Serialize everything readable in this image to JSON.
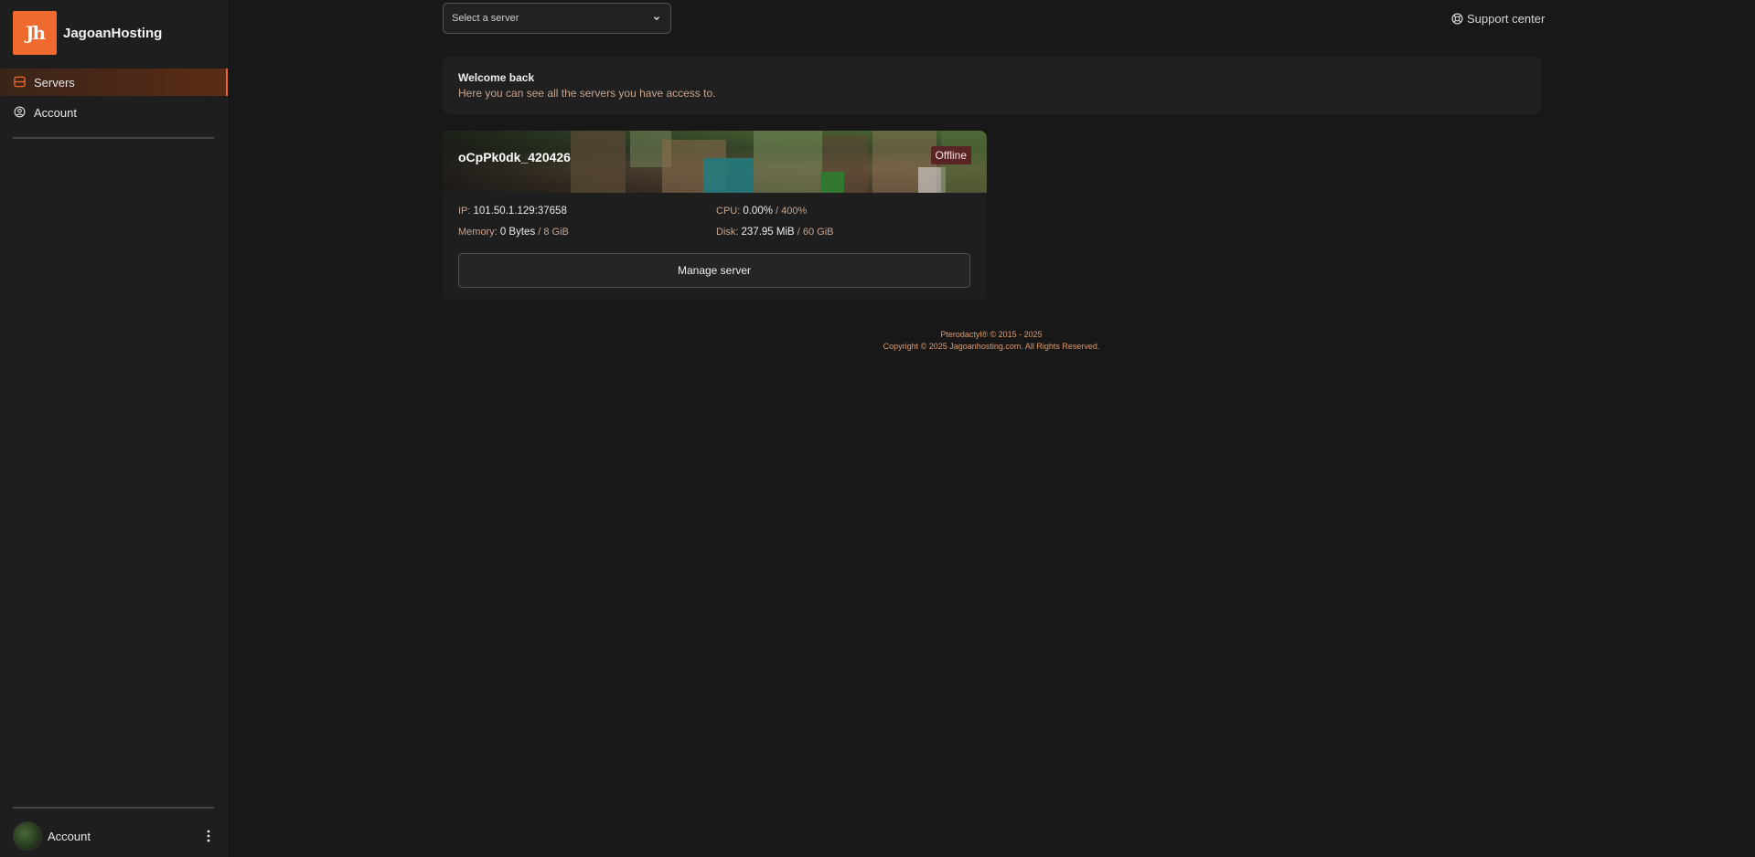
{
  "brand": {
    "name": "JagoanHosting",
    "logo_text": "Jh"
  },
  "sidebar": {
    "items": [
      {
        "label": "Servers",
        "icon": "server-icon",
        "active": true
      },
      {
        "label": "Account",
        "icon": "user-circle-icon",
        "active": false
      }
    ],
    "user": {
      "label": "Account"
    }
  },
  "header": {
    "server_select": {
      "placeholder": "Select a server"
    },
    "support": {
      "label": "Support center",
      "icon": "lifebuoy-icon"
    }
  },
  "welcome": {
    "title": "Welcome back",
    "subtitle": "Here you can see all the servers you have access to."
  },
  "servers": [
    {
      "name": "oCpPk0dk_420426",
      "status": "Offline",
      "ip_label": "IP:",
      "ip": "101.50.1.129:37658",
      "cpu_label": "CPU:",
      "cpu": "0.00%",
      "cpu_limit": "/ 400%",
      "memory_label": "Memory:",
      "memory": "0 Bytes",
      "memory_limit": "/ 8 GiB",
      "disk_label": "Disk:",
      "disk": "237.95 MiB",
      "disk_limit": "/ 60 GiB",
      "action": "Manage server"
    }
  ],
  "footer": {
    "line1": "Pterodactyl® © 2015 - 2025",
    "line2": "Copyright © 2025 Jagoanhosting.com. All Rights Reserved."
  },
  "colors": {
    "accent": "#ee6a2e",
    "background": "#181818",
    "offline": "#5a2424"
  }
}
